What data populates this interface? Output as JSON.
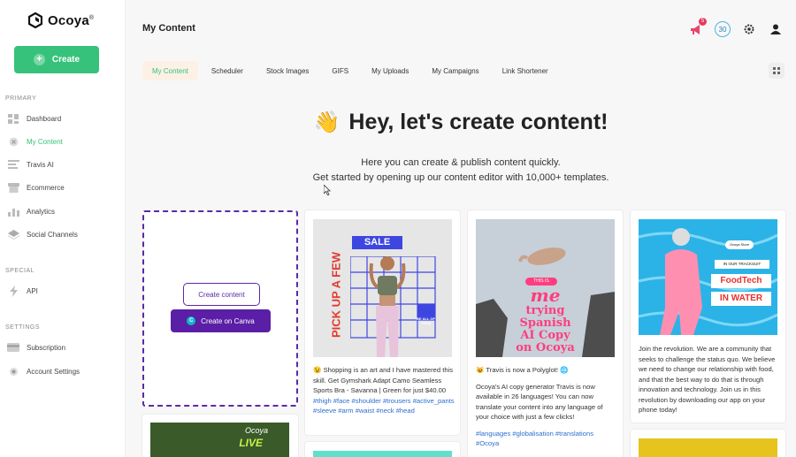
{
  "app": {
    "name": "Ocoya",
    "trademark": "®",
    "create_label": "Create",
    "page_title": "My Content"
  },
  "sidebar": {
    "sections": [
      {
        "label": "PRIMARY",
        "items": [
          {
            "label": "Dashboard",
            "icon": "dashboard-icon"
          },
          {
            "label": "My Content",
            "icon": "content-icon",
            "active": true
          },
          {
            "label": "Travis AI",
            "icon": "ai-icon"
          },
          {
            "label": "Ecommerce",
            "icon": "store-icon"
          },
          {
            "label": "Analytics",
            "icon": "analytics-icon"
          },
          {
            "label": "Social Channels",
            "icon": "channels-icon"
          }
        ]
      },
      {
        "label": "SPECIAL",
        "items": [
          {
            "label": "API",
            "icon": "api-icon"
          }
        ]
      },
      {
        "label": "SETTINGS",
        "items": [
          {
            "label": "Subscription",
            "icon": "card-icon"
          },
          {
            "label": "Account Settings",
            "icon": "gear-icon"
          }
        ]
      }
    ]
  },
  "topbar": {
    "notification_count": "5",
    "credits": "30"
  },
  "tabs": [
    "My Content",
    "Scheduler",
    "Stock Images",
    "GIFS",
    "My Uploads",
    "My Campaigns",
    "Link Shortener"
  ],
  "hero": {
    "emoji": "👋",
    "title": "Hey, let's create content!",
    "line1": "Here you can create & publish content quickly.",
    "line2": "Get started by opening up our content editor with 10,000+ templates."
  },
  "create_card": {
    "create_content": "Create content",
    "create_on_canva": "Create on Canva"
  },
  "cards": [
    {
      "image_texts": {
        "sale": "SALE",
        "vertical": "PICK UP A FEW",
        "tag": "BE ALL OF THEM"
      },
      "body": "😉 Shopping is an art and I have mastered this skill. Get Gymshark Adapt Camo Seamless Sports Bra - Savanna | Green for just $40.00",
      "tags": "#thigh #face #shoulder #trousers #active_pants #sleeve #arm #waist #neck #head"
    },
    {
      "image_texts": {
        "pill": "THIS IS",
        "me": "me",
        "line1": "trying",
        "line2": "Spanish",
        "line3": "AI Copy",
        "line4": "on Ocoya"
      },
      "intro": "😺 Travis is now a Polyglot! 🌐",
      "body": "Ocoya's AI copy generator Travis is now available in 26 languages! You can now translate your content into any language of your choice with just a few clicks!",
      "tags": "#languages #globalisation #translations #Ocoya"
    },
    {
      "image_texts": {
        "logo": "Ocoya Store",
        "banner": "IN OUR TRACKSUIT",
        "line1": "FoodTech",
        "line2": "IN WATER"
      },
      "body": "Join the revolution. We are a community that seeks to challenge the status quo. We believe we need to change our relationship with food, and that the best way to do that is through innovation and technology. Join us in this revolution by downloading our app on your phone today!"
    }
  ],
  "below_cards": {
    "first_text": "Ocoya",
    "first_sub": "LIVE"
  },
  "colors": {
    "accent": "#36c27a",
    "canva_purple": "#5b1ea6",
    "tag_blue": "#2c6fd1"
  }
}
